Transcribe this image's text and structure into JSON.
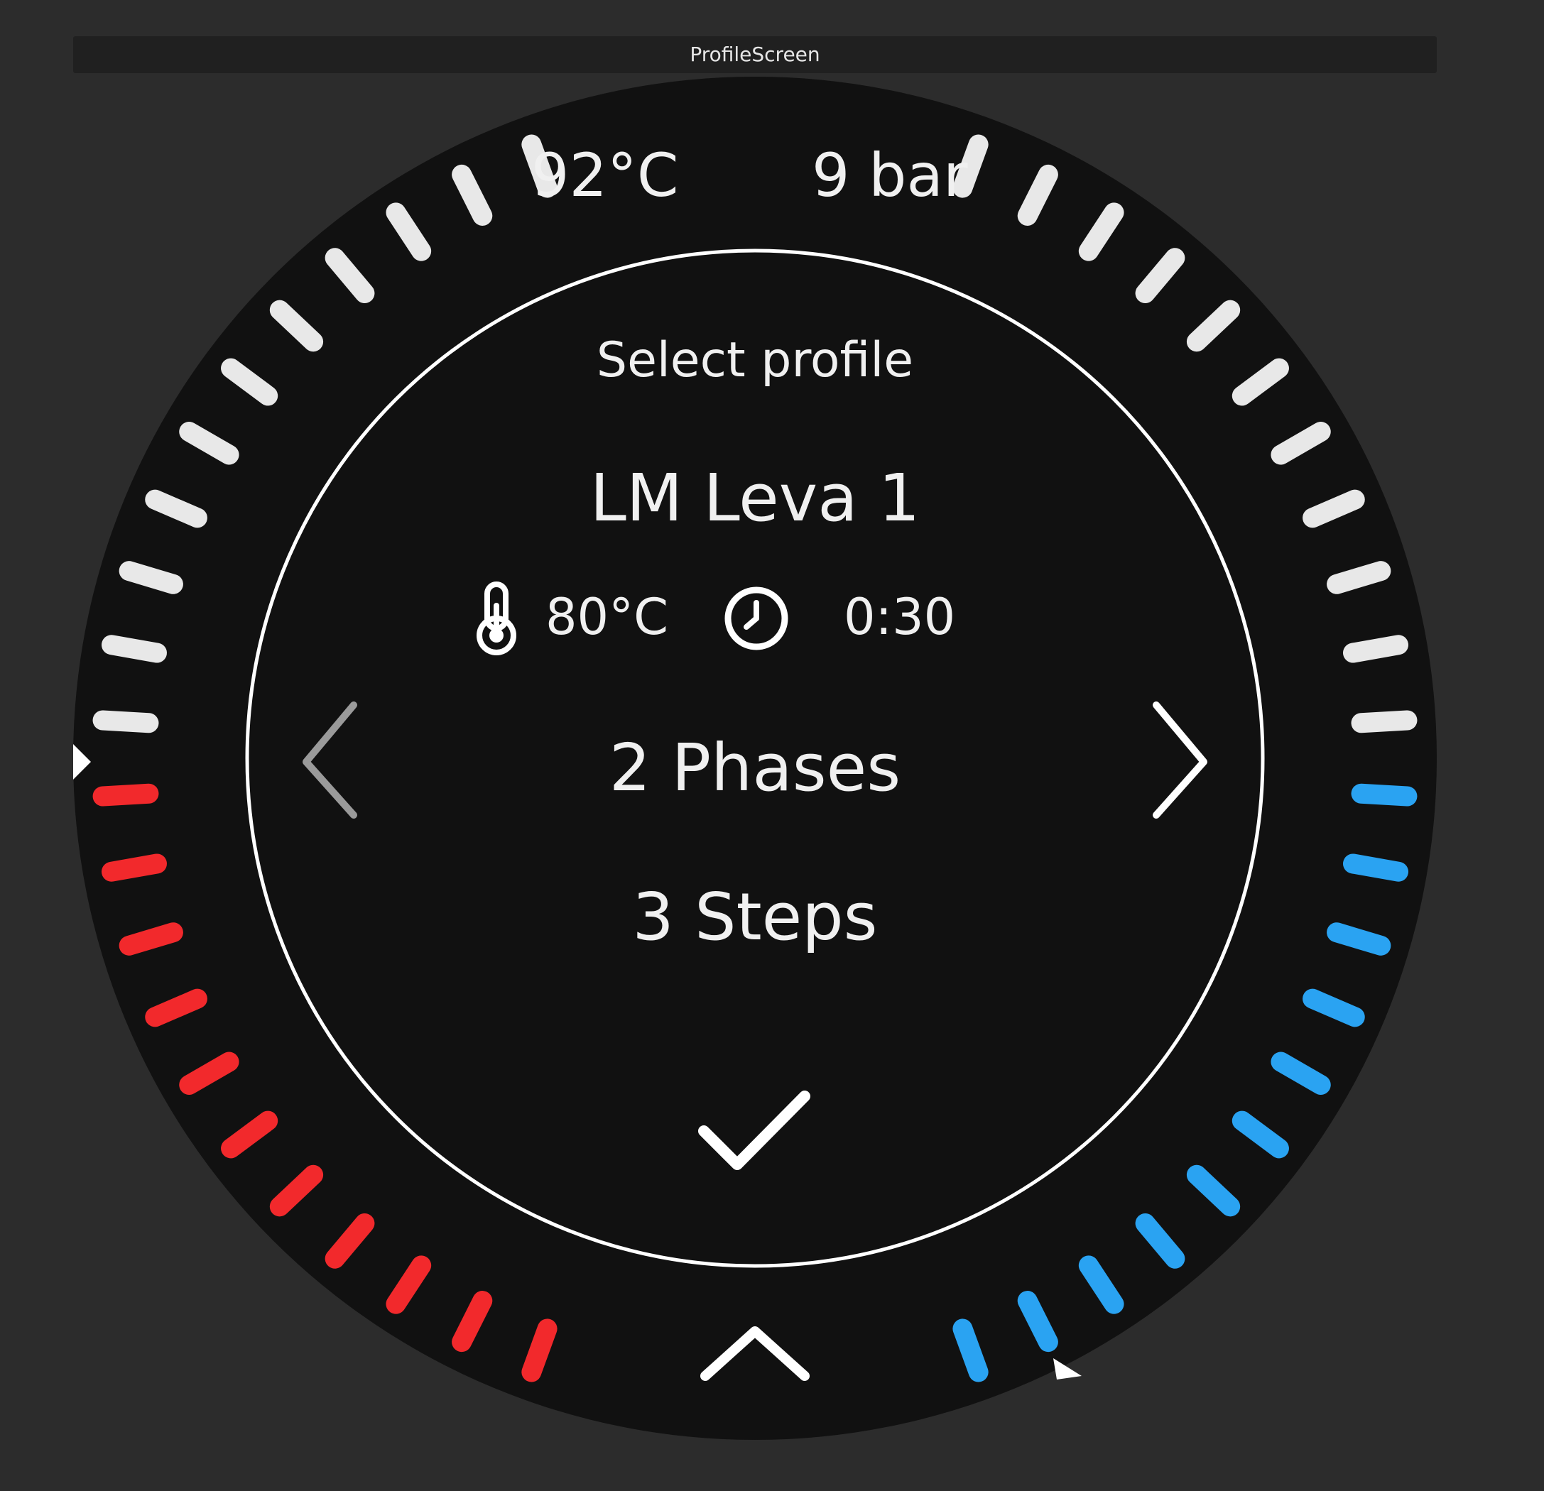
{
  "window": {
    "title": "ProfileScreen"
  },
  "status": {
    "temperature": "92°C",
    "pressure": "9 bar"
  },
  "screen": {
    "heading": "Select profile",
    "profile": {
      "name": "LM Leva 1",
      "temperature": "80°C",
      "duration": "0:30",
      "phases": "2 Phases",
      "steps": "3 Steps"
    }
  },
  "gauges": {
    "temperature": {
      "level": 0.5,
      "color": "#f2292c"
    },
    "pressure": {
      "level": 0.49,
      "color": "#2aa3f2"
    }
  },
  "colors": {
    "background": "#111111",
    "inactive_tick": "#e8e8e8",
    "ring": "#ffffff"
  },
  "icons": [
    "thermometer-icon",
    "clock-icon",
    "chevron-left-icon",
    "chevron-right-icon",
    "check-icon",
    "chevron-up-icon"
  ]
}
